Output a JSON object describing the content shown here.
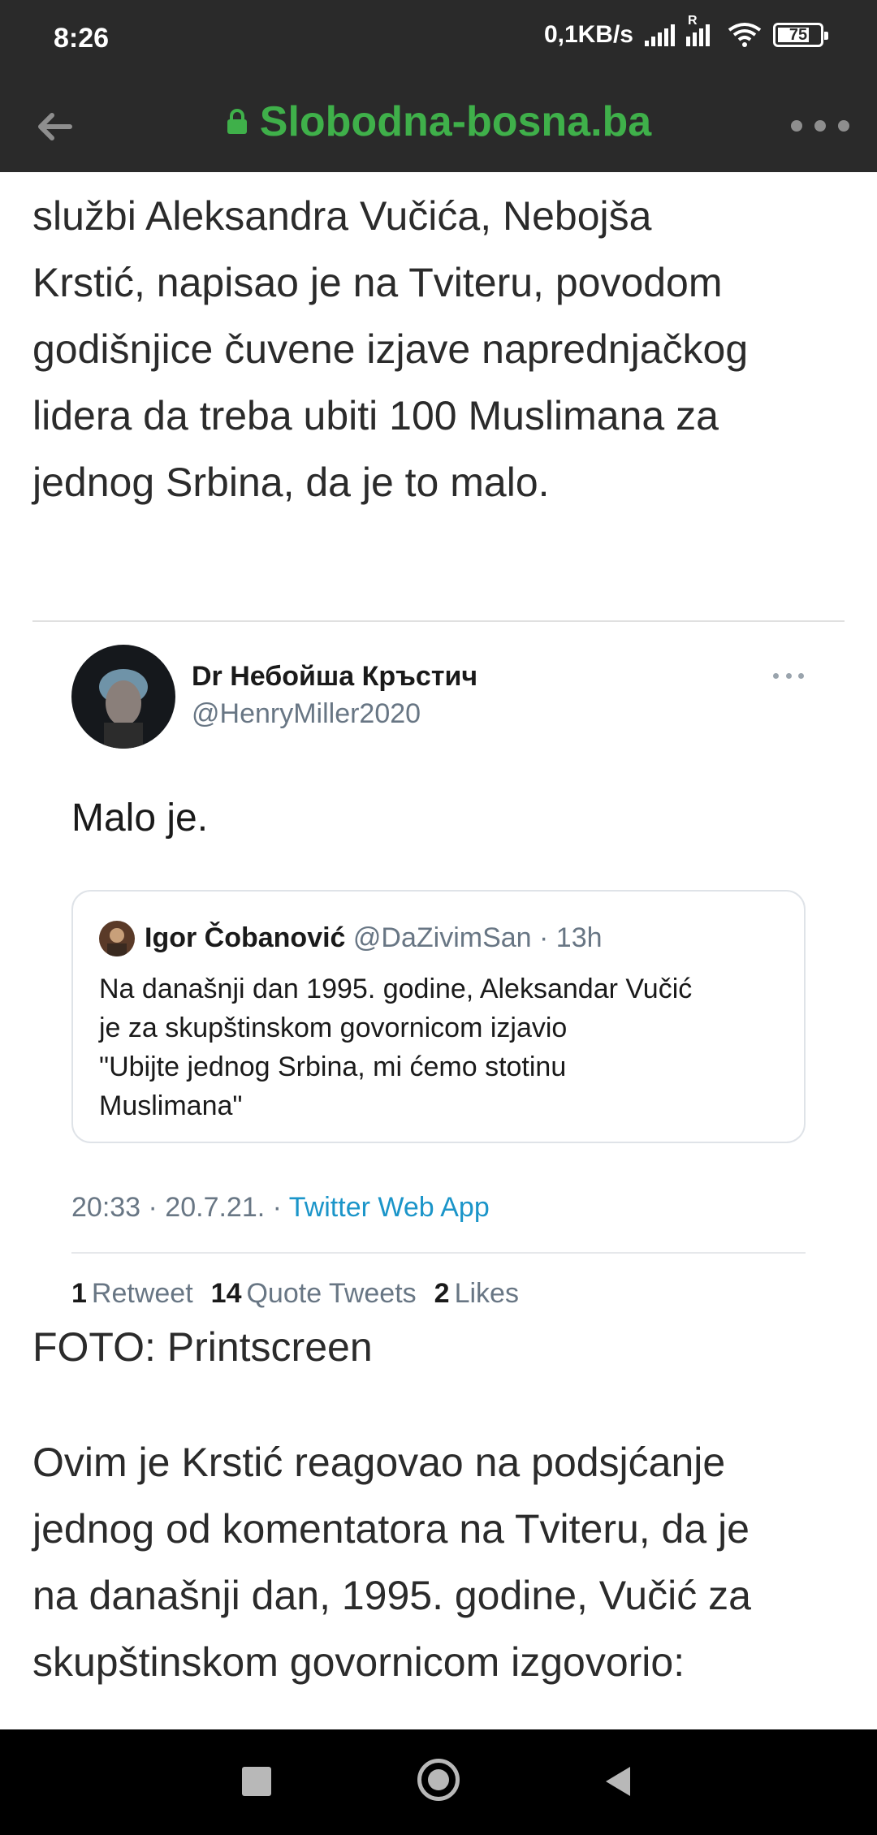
{
  "status_bar": {
    "time": "8:26",
    "network_speed": "0,1KB/s",
    "roaming_label": "R",
    "battery_text": "75",
    "battery_level": 0.75
  },
  "browser": {
    "url": "Slobodna-bosna.ba",
    "accent_color": "#3fb04a"
  },
  "article": {
    "paragraph_1_lines": [
      "službi Aleksandra Vučića, Nebojša",
      "Krstić, napisao je na Tviteru, povodom",
      "godišnjice čuvene izjave naprednjačkog",
      "lidera da treba ubiti 100 Muslimana za",
      "jednog Srbina, da je to malo."
    ],
    "caption": "FOTO: Printscreen",
    "paragraph_2_lines": [
      "Ovim je Krstić reagovao na podsjćanje",
      "jednog od komentatora na Tviteru, da je",
      "na današnji dan, 1995. godine, Vučić za",
      "skupštinskom govornicom izgovorio:"
    ]
  },
  "tweet": {
    "author_name": "Dr Небойша Кръстич",
    "author_handle": "@HenryMiller2020",
    "text": "Malo je.",
    "quote": {
      "name": "Igor Čobanović",
      "meta": "@DaZivimSan · 13h",
      "lines": [
        "Na današnji dan 1995. godine, Aleksandar Vučić",
        "je za skupštinskom govornicom izjavio",
        "\"Ubijte jednog Srbina, mi ćemo stotinu",
        "Muslimana\""
      ]
    },
    "time": "20:33 · 20.7.21. · ",
    "app": "Twitter Web App",
    "stats": {
      "retweets_count": "1",
      "retweets_label": "Retweet",
      "quotes_count": "14",
      "quotes_label": "Quote Tweets",
      "likes_count": "2",
      "likes_label": "Likes"
    }
  },
  "icons": {
    "back": "back-arrow-icon",
    "lock": "lock-icon",
    "more": "more-dots-icon",
    "nav_recent": "square-icon",
    "nav_home": "circle-icon",
    "nav_back": "triangle-icon"
  }
}
